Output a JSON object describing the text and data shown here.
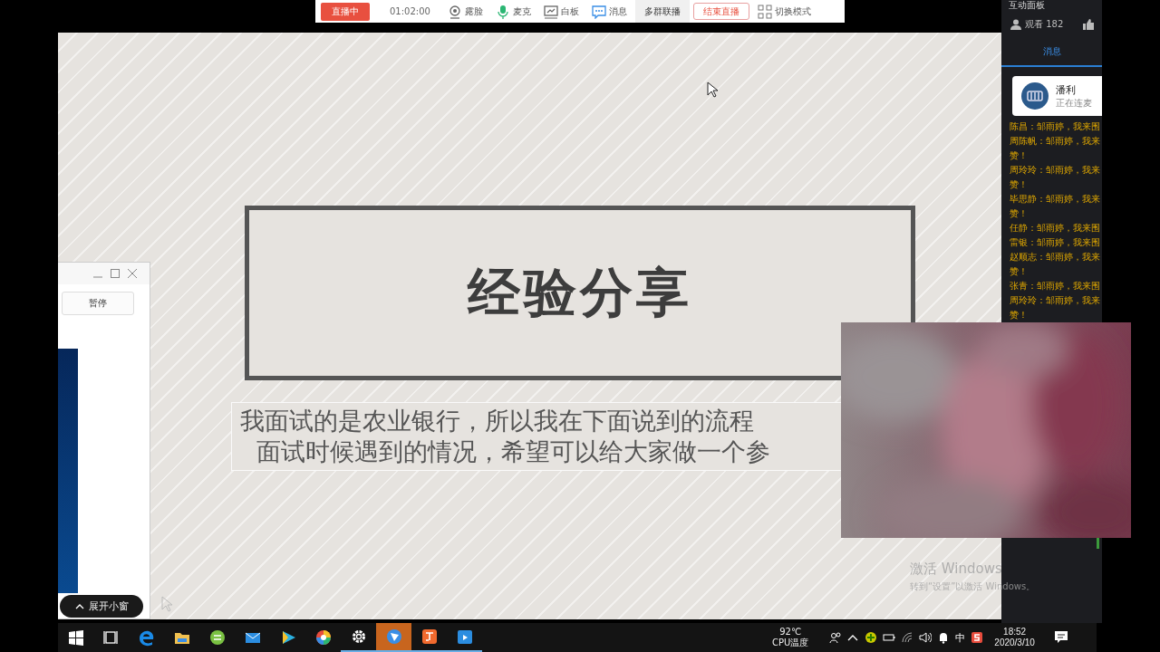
{
  "toolbar": {
    "live_badge": "直播中",
    "timer": "01:02:00",
    "items": [
      {
        "kind": "camera",
        "label": "露脸"
      },
      {
        "kind": "mic",
        "label": "麦克"
      },
      {
        "kind": "whiteboard",
        "label": "白板"
      },
      {
        "kind": "chat",
        "label": "消息"
      }
    ],
    "multi_button": "多群联播",
    "end_button": "结束直播",
    "mode_button": "切换模式"
  },
  "slide": {
    "title": "经验分享",
    "subtitle_lines": [
      "我面试的是农业银行，所以我在下面说到的流程",
      "面试时候遇到的情况，希望可以给大家做一个参"
    ]
  },
  "mini_window": {
    "pause_button": "暂停",
    "expand_button": "展开小窗"
  },
  "panel": {
    "title": "互动面板",
    "viewers": "观看 182",
    "tabs": [
      {
        "label": "消息",
        "selected": true
      }
    ],
    "speaker": {
      "name": "潘利",
      "status": "正在连麦"
    },
    "messages": [
      {
        "lines": [
          "陈昌：邹雨婷，我来围"
        ]
      },
      {
        "lines": [
          "周陈帆：邹雨婷，我来",
          "赞！"
        ]
      },
      {
        "lines": [
          "周玲玲：邹雨婷，我来",
          "赞！"
        ]
      },
      {
        "lines": [
          "毕思静：邹雨婷，我来",
          "赞！"
        ]
      },
      {
        "lines": [
          "任静：邹雨婷，我来围"
        ]
      },
      {
        "lines": [
          "雷银：邹雨婷，我来围"
        ]
      },
      {
        "lines": [
          "赵顺志：邹雨婷，我来",
          "赞！"
        ]
      },
      {
        "lines": [
          "张青：邹雨婷，我来围"
        ]
      },
      {
        "lines": [
          "周玲玲：邹雨婷，我来",
          "赞！"
        ]
      }
    ]
  },
  "watermark": {
    "title": "激活 Windows",
    "hint": "转到“设置”以激活 Windows。"
  },
  "taskbar": {
    "apps": [
      {
        "kind": "start",
        "open": false,
        "selected": false
      },
      {
        "kind": "taskview",
        "open": false,
        "selected": false
      },
      {
        "kind": "edge",
        "open": false,
        "selected": false
      },
      {
        "kind": "folder",
        "open": false,
        "selected": false
      },
      {
        "kind": "greenapp",
        "open": false,
        "selected": false
      },
      {
        "kind": "mail",
        "open": false,
        "selected": false
      },
      {
        "kind": "player",
        "open": false,
        "selected": false
      },
      {
        "kind": "colorball",
        "open": false,
        "selected": false
      },
      {
        "kind": "gear",
        "open": true,
        "selected": false
      },
      {
        "kind": "bird",
        "open": true,
        "selected": true
      },
      {
        "kind": "orangeapp",
        "open": true,
        "selected": false
      },
      {
        "kind": "calendar",
        "open": true,
        "selected": false
      }
    ],
    "cpu_temp": "92℃",
    "cpu_label": "CPU温度",
    "tray": [
      {
        "kind": "people"
      },
      {
        "kind": "caret"
      },
      {
        "kind": "plus"
      },
      {
        "kind": "battery"
      },
      {
        "kind": "wifi"
      },
      {
        "kind": "volume"
      },
      {
        "kind": "bell"
      },
      {
        "kind": "ime",
        "label": "中"
      },
      {
        "kind": "sapp"
      }
    ],
    "time": "18:52",
    "date": "2020/3/10"
  }
}
